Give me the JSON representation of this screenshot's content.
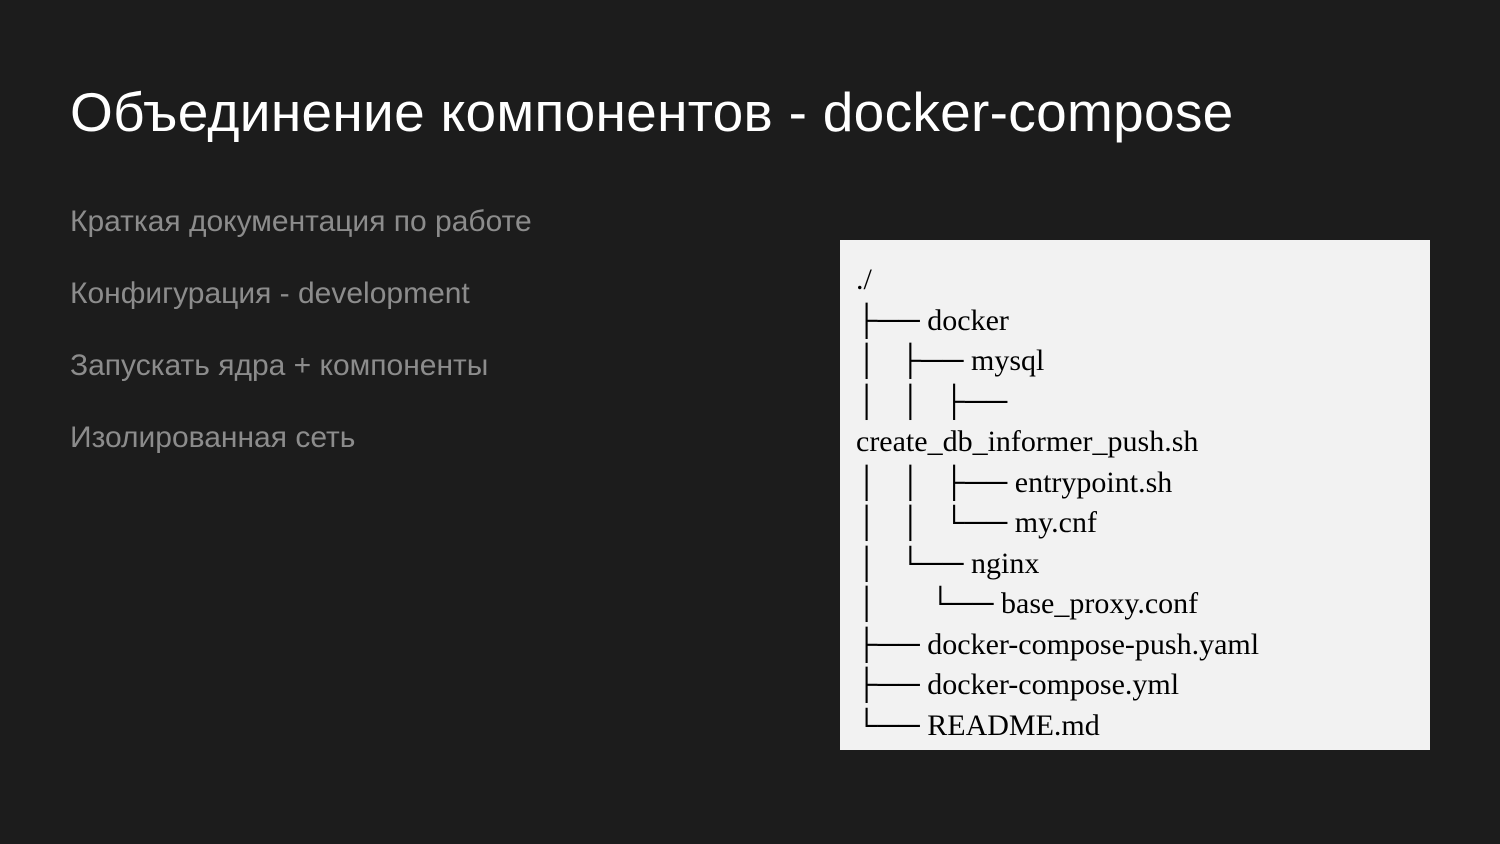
{
  "title": "Объединение компонентов - docker-compose",
  "bullets": {
    "b1": "Краткая документация по работе",
    "b2": "Конфигурация - development",
    "b3": "Запускать ядра + компоненты",
    "b4": "Изолированная сеть"
  },
  "tree": "./\n├── docker\n│   ├── mysql\n│   │   ├── \ncreate_db_informer_push.sh\n│   │   ├── entrypoint.sh\n│   │   └── my.cnf\n│   └── nginx\n│       └── base_proxy.conf\n├── docker-compose-push.yaml\n├── docker-compose.yml\n└── README.md"
}
